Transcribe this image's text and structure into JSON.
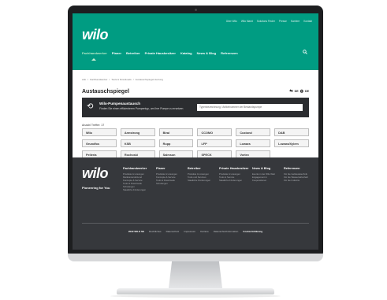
{
  "header": {
    "logo": "wilo",
    "topnav": [
      "Über Wilo",
      "Wilo Markt",
      "Solutions Finder",
      "Presse",
      "Karriere",
      "Kontakt"
    ],
    "mainnav": [
      "Fachhandwerker",
      "Planer",
      "Betreiber",
      "Private Hausbesitzer",
      "Katalog",
      "News & Blog",
      "Referenzen"
    ],
    "active_nav": "Fachhandwerker"
  },
  "breadcrumb": [
    "wilo",
    "/",
    "Fachhandwerker",
    "/",
    "Tools & Downloads",
    "/",
    "Austauschspiegel Heizung"
  ],
  "page": {
    "title": "Austauschspiegel",
    "lang_code": "DE",
    "region_code": "DE"
  },
  "finder": {
    "title": "Wilo-Pumpenaustausch",
    "description": "Finden Sie einen effizienteren Pumpentyp, um Ihre Pumpe zu ersetzen",
    "placeholder": "Typenbezeichnung / Artikelnummer der Bestandspumpe"
  },
  "results": {
    "count_label": "Anzahl Treffer: 17",
    "brands": [
      "Wilo",
      "Armstrong",
      "Biral",
      "CCOMO",
      "Custond",
      "DAB",
      "Grundfos",
      "KSB",
      "Rupp",
      "LFP",
      "Lowara",
      "Lowara/Xylem",
      "Pelleria",
      "Rochoski",
      "Salmson",
      "SPECK",
      "Vortex"
    ]
  },
  "footer": {
    "logo": "wilo",
    "slogan": "Pioneering for You",
    "columns": [
      {
        "heading": "Fachhandwerker",
        "links": [
          "Produkte & Lösungen",
          "Marktunterstützend",
          "Konzepte & Service",
          "Tools & Downloads",
          "Schulungen",
          "Staatliche Förderungen"
        ]
      },
      {
        "heading": "Planer",
        "links": [
          "Produkte & Lösungen",
          "Konzepte & Service",
          "Tools & Downloads",
          "Schulungen"
        ]
      },
      {
        "heading": "Betreiber",
        "links": [
          "Produkte & Lösungen",
          "Tools und Services",
          "Staatliche Förderungen"
        ]
      },
      {
        "heading": "Private Hausbesitzer",
        "links": [
          "Produkte & Lösungen",
          "Tools & Service",
          "Staatliche Förderungen"
        ]
      },
      {
        "heading": "News & Blog",
        "links": [
          "Events in der Wilo Welt",
          "Engagement &",
          "Kooperationen"
        ]
      },
      {
        "heading": "Referenzen",
        "links": [
          "Für die Gebäudetechnik",
          "Für die Wasserwirtschaft",
          "Für die Industrie"
        ]
      }
    ],
    "bottom": [
      "2022 WILO SE",
      "Rechtliches",
      "Datenschutz",
      "Impressum",
      "Karriere",
      "Datenschutzinformation",
      "Cookie Erklärung"
    ]
  },
  "colors": {
    "brand_green": "#009c82",
    "finder_bg": "#2b2d30",
    "footer_bg": "#36383c"
  }
}
